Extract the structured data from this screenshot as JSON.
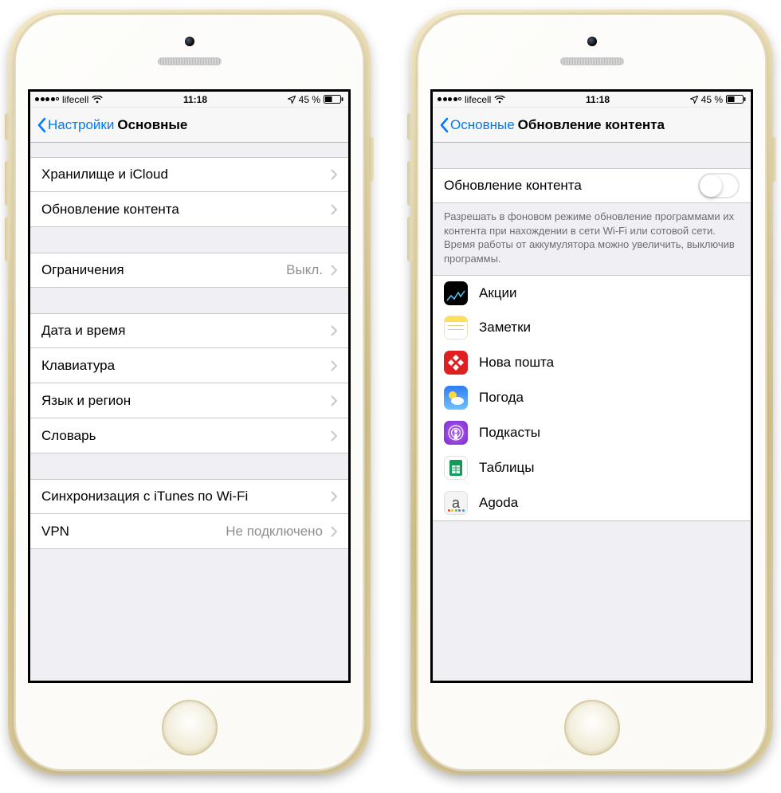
{
  "status": {
    "carrier": "lifecell",
    "time": "11:18",
    "battery_pct": "45 %"
  },
  "left_screen": {
    "back_label": "Настройки",
    "title": "Основные",
    "rows": {
      "storage": "Хранилище и iCloud",
      "background_refresh": "Обновление контента",
      "restrictions": "Ограничения",
      "restrictions_value": "Выкл.",
      "date_time": "Дата и время",
      "keyboard": "Клавиатура",
      "language_region": "Язык и регион",
      "dictionary": "Словарь",
      "itunes_wifi_sync": "Синхронизация с iTunes по Wi-Fi",
      "vpn": "VPN",
      "vpn_value": "Не подключено"
    }
  },
  "right_screen": {
    "back_label": "Основные",
    "title": "Обновление контента",
    "master_label": "Обновление контента",
    "master_on": false,
    "footer": "Разрешать в фоновом режиме обновление программами их контента при нахождении в сети Wi-Fi или сотовой сети. Время работы от аккумулятора можно увеличить, выключив программы.",
    "apps": [
      {
        "id": "stocks",
        "name": "Акции"
      },
      {
        "id": "notes",
        "name": "Заметки"
      },
      {
        "id": "nova",
        "name": "Нова пошта"
      },
      {
        "id": "weather",
        "name": "Погода"
      },
      {
        "id": "podcasts",
        "name": "Подкасты"
      },
      {
        "id": "sheets",
        "name": "Таблицы"
      },
      {
        "id": "agoda",
        "name": "Agoda"
      }
    ]
  }
}
